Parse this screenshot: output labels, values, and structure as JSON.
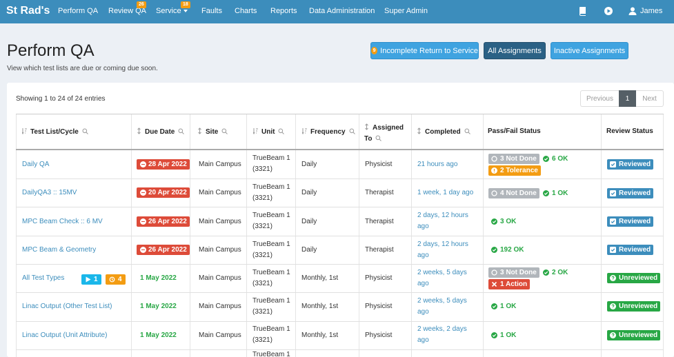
{
  "nav": {
    "brand": "St Rad's",
    "items": [
      {
        "label": "Perform QA",
        "badge": ""
      },
      {
        "label": "Review QA",
        "badge": "26"
      },
      {
        "label": "Service",
        "badge": "18"
      },
      {
        "label": "Faults",
        "badge": ""
      },
      {
        "label": "Charts",
        "badge": ""
      },
      {
        "label": "Reports",
        "badge": ""
      },
      {
        "label": "Data Administration",
        "badge": ""
      },
      {
        "label": "Super Admin",
        "badge": ""
      }
    ],
    "user": "James",
    "icons": [
      "book-icon",
      "play-circle-icon",
      "user-icon"
    ]
  },
  "header": {
    "title": "Perform QA",
    "subtitle": "View which test lists are due or coming due soon.",
    "buttons": {
      "incomplete_badge": "9",
      "incomplete": "Incomplete Return to Service",
      "all": "All Assignments",
      "inactive": "Inactive Assignments"
    }
  },
  "table": {
    "showing": "Showing 1 to 24 of 24 entries",
    "pager": {
      "prev": "Previous",
      "page": "1",
      "next": "Next"
    },
    "columns": {
      "test_list": "Test List/Cycle",
      "due": "Due Date",
      "site": "Site",
      "unit": "Unit",
      "frequency": "Frequency",
      "assigned_1": "Assigned",
      "assigned_2": "To",
      "completed": "Completed",
      "status": "Pass/Fail Status",
      "review": "Review Status"
    },
    "rows": [
      {
        "name": "Daily QA",
        "due": "28 Apr 2022",
        "site": "Main Campus",
        "unit1": "TrueBeam 1",
        "unit2": "(3321)",
        "freq": "Daily",
        "assigned": "Physicist",
        "completed1": "21 hours ago",
        "completed2": "",
        "notdone": "3 Not Done",
        "ok": "6 OK",
        "second": "2 Tolerance",
        "review": "Reviewed"
      },
      {
        "name": "DailyQA3 :: 15MV",
        "due": "20 Apr 2022",
        "site": "Main Campus",
        "unit1": "TrueBeam 1",
        "unit2": "(3321)",
        "freq": "Daily",
        "assigned": "Therapist",
        "completed1": "1 week, 1 day ago",
        "completed2": "",
        "notdone": "4 Not Done",
        "ok": "1 OK",
        "second": "",
        "review": "Reviewed"
      },
      {
        "name": "MPC Beam Check :: 6 MV",
        "due": "26 Apr 2022",
        "site": "Main Campus",
        "unit1": "TrueBeam 1",
        "unit2": "(3321)",
        "freq": "Daily",
        "assigned": "Therapist",
        "completed1": "2 days, 12 hours",
        "completed2": "ago",
        "notdone": "",
        "ok": "3 OK",
        "second": "",
        "review": "Reviewed"
      },
      {
        "name": "MPC Beam & Geometry",
        "due": "26 Apr 2022",
        "site": "Main Campus",
        "unit1": "TrueBeam 1",
        "unit2": "(3321)",
        "freq": "Daily",
        "assigned": "Therapist",
        "completed1": "2 days, 12 hours",
        "completed2": "ago",
        "notdone": "",
        "ok": "192 OK",
        "second": "",
        "review": "Reviewed"
      },
      {
        "name": "All Test Types",
        "badge_play": "1",
        "badge_orange": "4",
        "due": "1 May 2022",
        "site": "Main Campus",
        "unit1": "TrueBeam 1",
        "unit2": "(3321)",
        "freq": "Monthly, 1st",
        "assigned": "Physicist",
        "completed1": "2 weeks, 5 days",
        "completed2": "ago",
        "notdone": "3 Not Done",
        "ok": "2 OK",
        "second": "1 Action",
        "review": "Unreviewed"
      },
      {
        "name": "Linac Output (Other Test List)",
        "due": "1 May 2022",
        "site": "Main Campus",
        "unit1": "TrueBeam 1",
        "unit2": "(3321)",
        "freq": "Monthly, 1st",
        "assigned": "Physicist",
        "completed1": "2 weeks, 5 days",
        "completed2": "ago",
        "notdone": "",
        "ok": "1 OK",
        "second": "",
        "review": "Unreviewed"
      },
      {
        "name": "Linac Output (Unit Attribute)",
        "due": "1 May 2022",
        "site": "Main Campus",
        "unit1": "TrueBeam 1",
        "unit2": "(3321)",
        "freq": "Monthly, 1st",
        "assigned": "Physicist",
        "completed1": "2 weeks, 2 days",
        "completed2": "ago",
        "notdone": "",
        "ok": "1 OK",
        "second": "",
        "review": "Unreviewed"
      },
      {
        "name": "",
        "due": "",
        "site": "",
        "unit1": "TrueBeam 1",
        "unit2": "",
        "freq": "",
        "assigned": "",
        "completed1": "",
        "completed2": "",
        "notdone": "",
        "ok": "",
        "second": "",
        "review": ""
      }
    ]
  },
  "colors": {
    "nav": "#3c8dbc",
    "red": "#dd4b39",
    "green": "#28a745",
    "orange": "#f39c12",
    "gray": "#b1b6bb"
  }
}
